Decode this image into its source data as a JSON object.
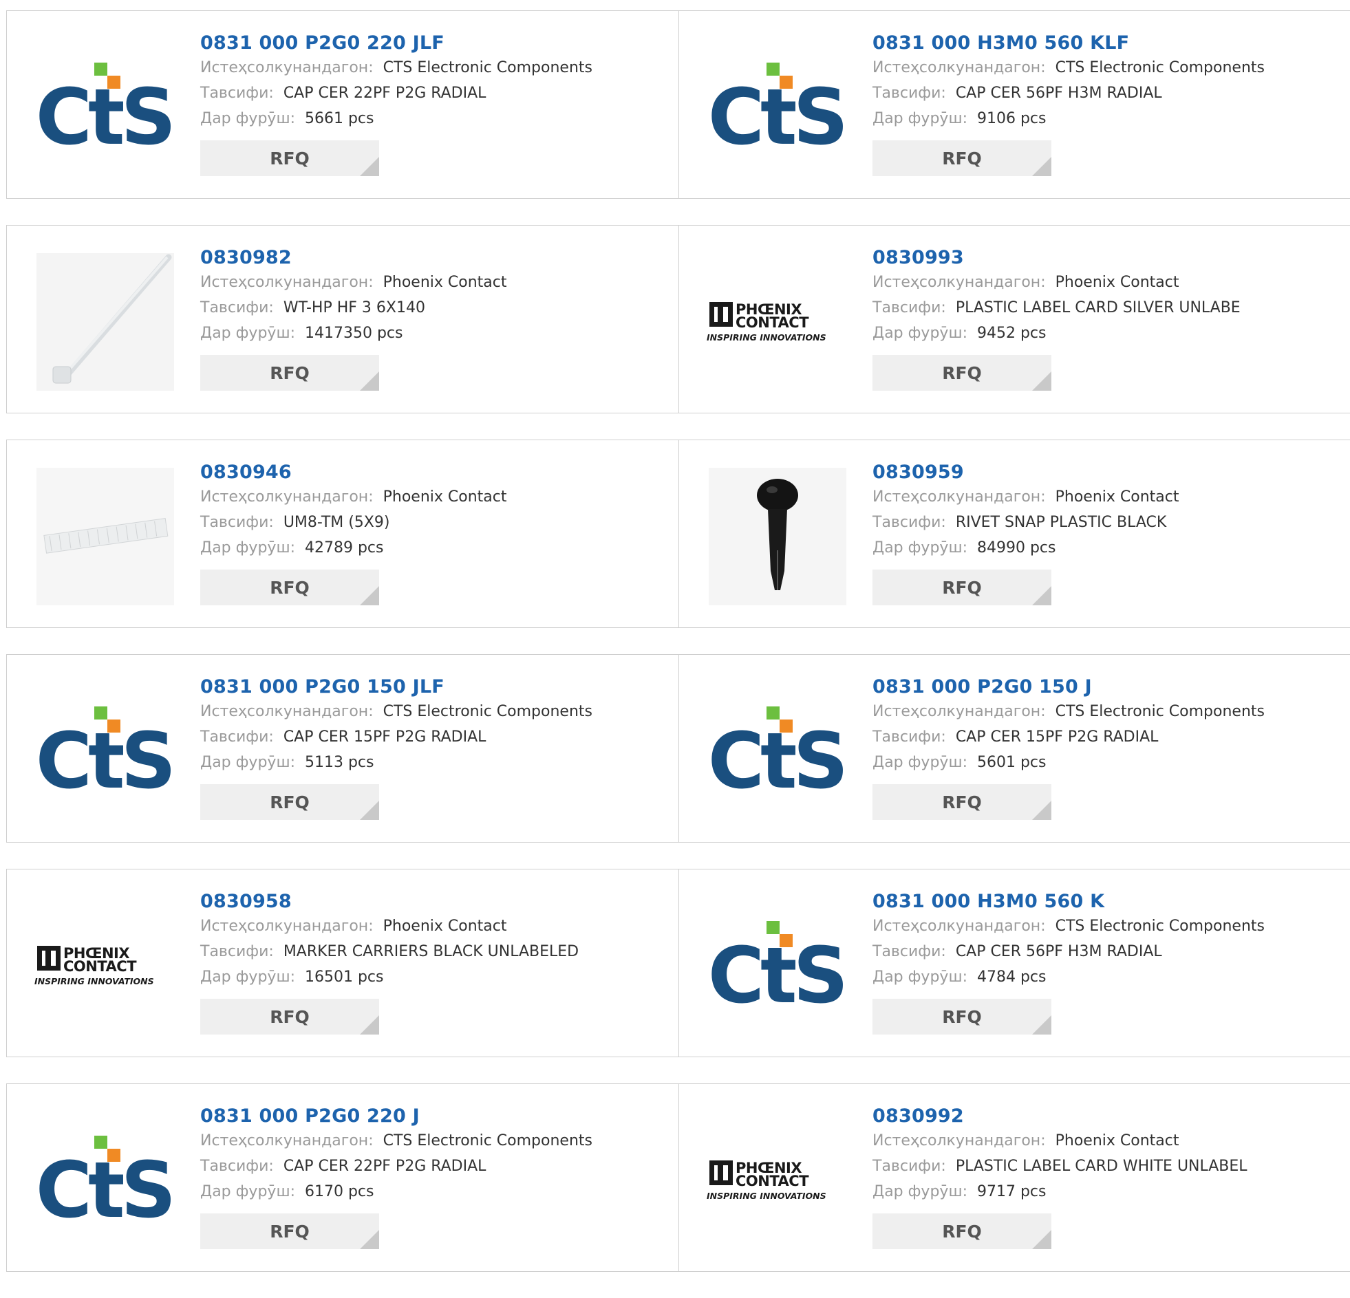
{
  "labels": {
    "manufacturer": "Истеҳсолкунандагон:",
    "description": "Тавсифи:",
    "stock": "Дар фурӯш:",
    "rfq": "RFQ"
  },
  "logo_text": {
    "cts": "CtS",
    "phoenix_line1": "PHŒNIX",
    "phoenix_line2": "CONTACT",
    "phoenix_tag": "INSPIRING INNOVATIONS"
  },
  "colors": {
    "link": "#1d63ad",
    "cts_blue": "#1a4f7f",
    "cts_green": "#6cbf3f",
    "cts_orange": "#f08a24"
  },
  "products": [
    {
      "part": "0831 000 P2G0 220 JLF",
      "manufacturer": "CTS Electronic Components",
      "description": "CAP CER 22PF P2G RADIAL",
      "stock": "5661 pcs",
      "image": "cts-logo"
    },
    {
      "part": "0831 000 H3M0 560 KLF",
      "manufacturer": "CTS Electronic Components",
      "description": "CAP CER 56PF H3M RADIAL",
      "stock": "9106 pcs",
      "image": "cts-logo"
    },
    {
      "part": "0830982",
      "manufacturer": "Phoenix Contact",
      "description": "WT-HP HF 3 6X140",
      "stock": "1417350 pcs",
      "image": "cable-tie"
    },
    {
      "part": "0830993",
      "manufacturer": "Phoenix Contact",
      "description": "PLASTIC LABEL CARD SILVER UNLABE",
      "stock": "9452 pcs",
      "image": "phoenix-logo"
    },
    {
      "part": "0830946",
      "manufacturer": "Phoenix Contact",
      "description": "UM8-TM (5X9)",
      "stock": "42789 pcs",
      "image": "marker-strip"
    },
    {
      "part": "0830959",
      "manufacturer": "Phoenix Contact",
      "description": "RIVET SNAP PLASTIC BLACK",
      "stock": "84990 pcs",
      "image": "rivet"
    },
    {
      "part": "0831 000 P2G0 150 JLF",
      "manufacturer": "CTS Electronic Components",
      "description": "CAP CER 15PF P2G RADIAL",
      "stock": "5113 pcs",
      "image": "cts-logo"
    },
    {
      "part": "0831 000 P2G0 150 J",
      "manufacturer": "CTS Electronic Components",
      "description": "CAP CER 15PF P2G RADIAL",
      "stock": "5601 pcs",
      "image": "cts-logo"
    },
    {
      "part": "0830958",
      "manufacturer": "Phoenix Contact",
      "description": "MARKER CARRIERS BLACK UNLABELED",
      "stock": "16501 pcs",
      "image": "phoenix-logo"
    },
    {
      "part": "0831 000 H3M0 560 K",
      "manufacturer": "CTS Electronic Components",
      "description": "CAP CER 56PF H3M RADIAL",
      "stock": "4784 pcs",
      "image": "cts-logo"
    },
    {
      "part": "0831 000 P2G0 220 J",
      "manufacturer": "CTS Electronic Components",
      "description": "CAP CER 22PF P2G RADIAL",
      "stock": "6170 pcs",
      "image": "cts-logo"
    },
    {
      "part": "0830992",
      "manufacturer": "Phoenix Contact",
      "description": "PLASTIC LABEL CARD WHITE UNLABEL",
      "stock": "9717 pcs",
      "image": "phoenix-logo"
    }
  ]
}
